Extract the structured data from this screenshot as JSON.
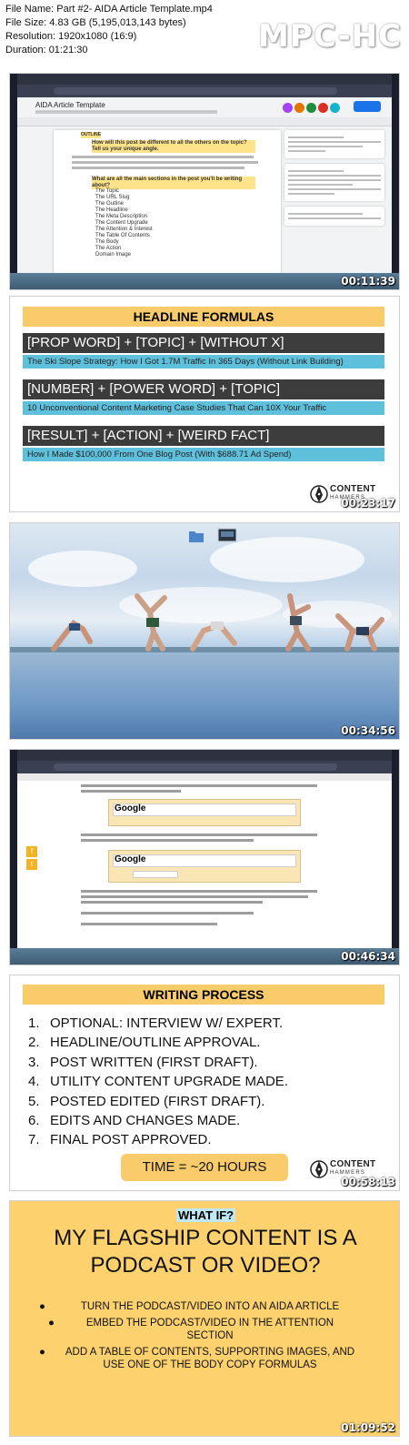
{
  "file_info": {
    "file_name": "File Name: Part #2- AIDA Article Template.mp4",
    "file_size": "File Size: 4.83 GB (5,195,013,143 bytes)",
    "resolution": "Resolution: 1920x1080 (16:9)",
    "duration": "Duration: 01:21:30"
  },
  "brand": "MPC-HC",
  "thumbnails": [
    {
      "timestamp": "00:11:39",
      "doc_title": "AIDA Article Template",
      "outline_tag": "OUTLINE",
      "q1": "How will this post be different to all the others on the topic? Tell us your unique angle.",
      "q2": "What are all the main sections in the post you'll be writing about?",
      "items": [
        "The Topic",
        "The URL Slug",
        "The Outline",
        "The Headline",
        "The Meta Description",
        "The Content Upgrade",
        "The Attention & Interest",
        "The Table Of Contents",
        "The Body",
        "The Action",
        "Domain Image"
      ]
    },
    {
      "timestamp": "00:23:17",
      "title": "HEADLINE FORMULAS",
      "formulas": [
        {
          "formula": "[PROP WORD] + [TOPIC] + [WITHOUT X]",
          "example": "The Ski Slope Strategy: How I Got 1.7M Traffic In 365 Days (Without Link Building)"
        },
        {
          "formula": "[NUMBER] + [POWER WORD] + [TOPIC]",
          "example": "10 Unconventional Content Marketing Case Studies That Can 10X Your Traffic"
        },
        {
          "formula": "[RESULT] + [ACTION] + [WEIRD FACT]",
          "example": "How I Made $100,000 From One Blog Post (With $688.71 Ad Spend)"
        }
      ],
      "logo_top": "CONTENT",
      "logo_bottom": "HAMMERS"
    },
    {
      "timestamp": "00:34:56"
    },
    {
      "timestamp": "00:46:34",
      "google_label": "Google"
    },
    {
      "timestamp": "00:58:13",
      "title": "WRITING PROCESS",
      "steps": [
        "OPTIONAL: INTERVIEW W/ EXPERT.",
        "HEADLINE/OUTLINE APPROVAL.",
        "POST WRITTEN (FIRST DRAFT).",
        "UTILITY CONTENT UPGRADE MADE.",
        "POSTED EDITED (FIRST DRAFT).",
        "EDITS AND CHANGES MADE.",
        "FINAL POST APPROVED."
      ],
      "time_box": "TIME = ~20 HOURS",
      "logo_top": "CONTENT",
      "logo_bottom": "HAMMERS"
    },
    {
      "timestamp": "01:09:52",
      "what_if": "WHAT IF?",
      "question": "MY FLAGSHIP CONTENT IS A PODCAST OR VIDEO?",
      "bullets": [
        "TURN THE PODCAST/VIDEO INTO AN AIDA ARTICLE",
        "EMBED THE PODCAST/VIDEO IN THE ATTENTION SECTION",
        "ADD A TABLE OF CONTENTS, SUPPORTING IMAGES, AND USE ONE OF THE BODY COPY FORMULAS"
      ]
    }
  ],
  "colors": {
    "accent_yellow": "#f9cb6b",
    "accent_blue": "#5fc0dc",
    "dark_bar": "#3c3c3c",
    "share_blue": "#1a73e8"
  }
}
